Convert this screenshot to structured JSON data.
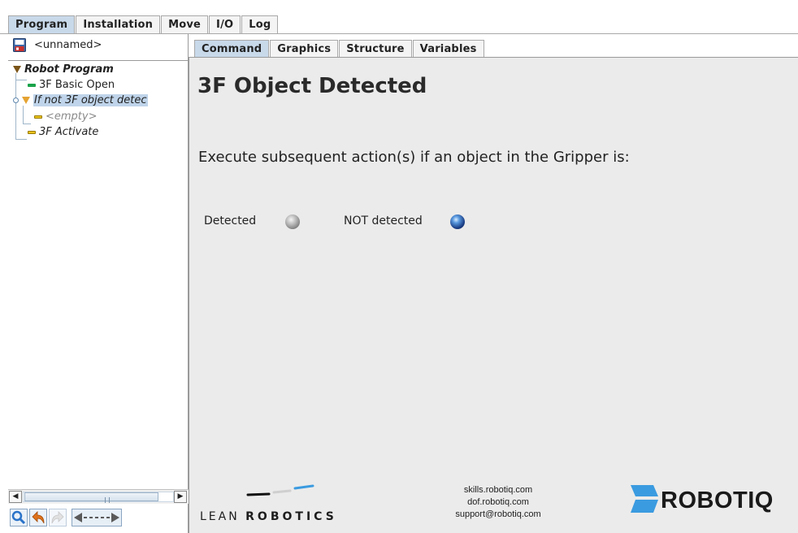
{
  "top_tabs": [
    "Program",
    "Installation",
    "Move",
    "I/O",
    "Log"
  ],
  "program": {
    "file_name": "<unnamed>"
  },
  "tree": {
    "root": "Robot Program",
    "nodes": [
      {
        "label": "3F Basic Open"
      },
      {
        "label": "If not 3F object detec"
      },
      {
        "label": "<empty>"
      },
      {
        "label": "3F Activate"
      }
    ]
  },
  "sub_tabs": [
    "Command",
    "Graphics",
    "Structure",
    "Variables"
  ],
  "command": {
    "title": "3F Object Detected",
    "instruction": "Execute subsequent action(s) if an object in the Gripper is:",
    "options": [
      {
        "label": "Detected",
        "selected": false
      },
      {
        "label": "NOT detected",
        "selected": true
      }
    ]
  },
  "footer": {
    "lean": "LEAN",
    "robotics": "ROBOTICS",
    "contacts": [
      "skills.robotiq.com",
      "dof.robotiq.com",
      "support@robotiq.com"
    ],
    "brand": "ROBOTIQ"
  },
  "colors": {
    "active_tab": "#c8d9ea",
    "brand_blue": "#3b9be0",
    "panel_bg": "#ebebeb",
    "selected_node_bg": "#bfd4ea"
  },
  "icons": [
    "save-icon",
    "search-icon",
    "undo-icon",
    "redo-icon",
    "move-arrows-icon"
  ]
}
